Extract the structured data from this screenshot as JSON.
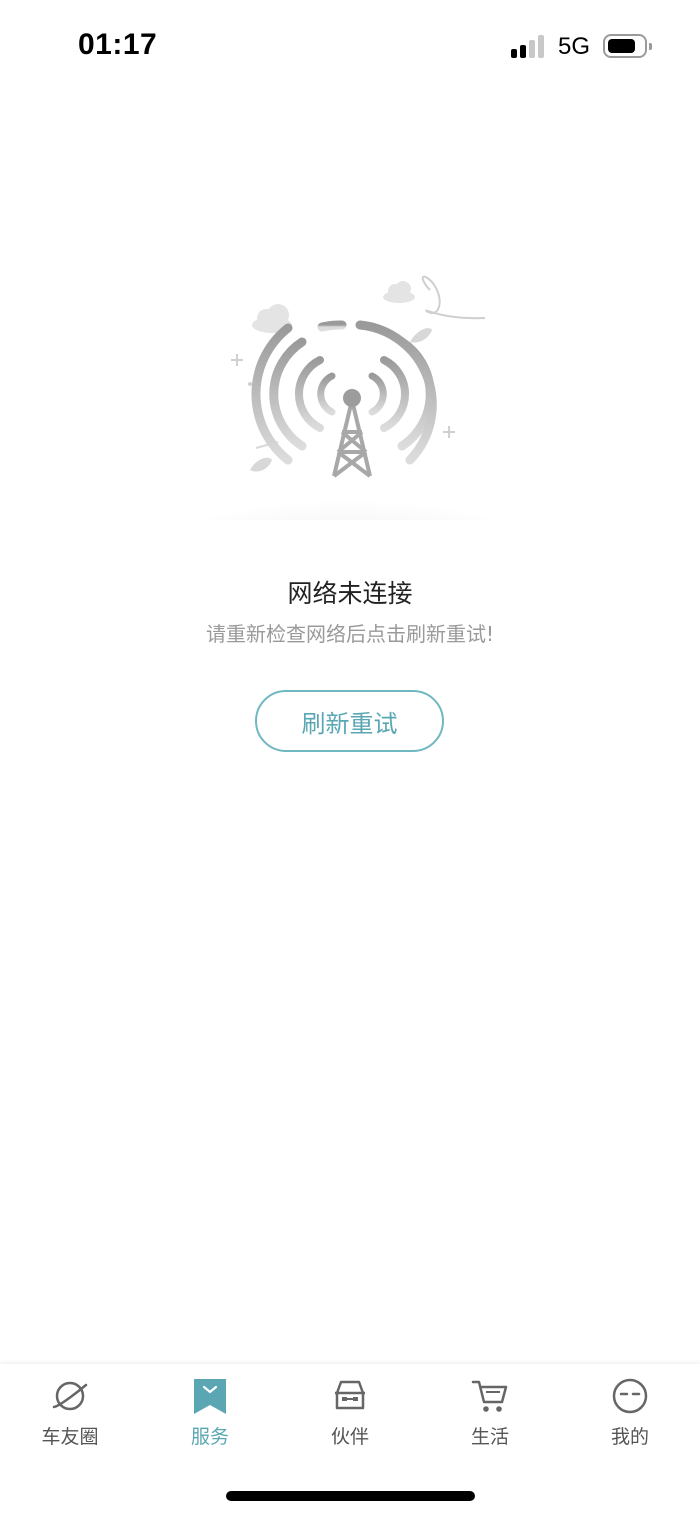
{
  "status_bar": {
    "time": "01:17",
    "network": "5G",
    "signal_bars_filled": 2,
    "signal_bars_total": 4
  },
  "empty_state": {
    "illustration_icon": "radio-tower-icon",
    "title": "网络未连接",
    "subtitle": "请重新检查网络后点击刷新重试!",
    "button_label": "刷新重试"
  },
  "tab_bar": {
    "active_color": "#5aa7b3",
    "items": [
      {
        "label": "车友圈",
        "icon": "planet-icon",
        "active": false
      },
      {
        "label": "服务",
        "icon": "bookmark-icon",
        "active": true
      },
      {
        "label": "伙伴",
        "icon": "car-front-icon",
        "active": false
      },
      {
        "label": "生活",
        "icon": "shopping-cart-icon",
        "active": false
      },
      {
        "label": "我的",
        "icon": "face-icon",
        "active": false
      }
    ]
  }
}
